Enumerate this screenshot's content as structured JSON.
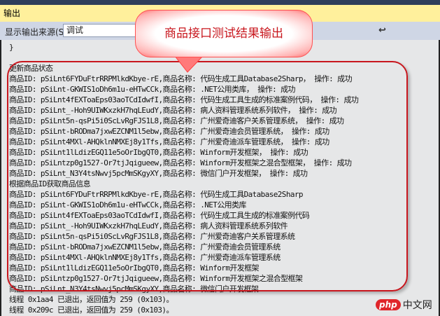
{
  "window": {
    "title": "输出"
  },
  "toolbar": {
    "source_label": "显示输出来源(S):",
    "source_value": "调试"
  },
  "callout": {
    "text": "商品接口测试结果输出"
  },
  "output": {
    "lines": [
      "}",
      "",
      "更新商品状态",
      "商品ID: pSiLnt6FYDuFtrRRPMlkdKbye-rE,商品名称: 代码生成工具Database2Sharp， 操作: 成功",
      "商品ID: pSiLnt-GKWIS1oDh6m1u-eHTwCCk,商品名称: .NET公用类库， 操作: 成功",
      "商品ID: pSiLnt4fEXToaEps03aoTCdIdwfI,商品名称: 代码生成工具生成的标准案例代码， 操作: 成功",
      "商品ID: pSiLnt_-Hoh9UIWKxzkH7hqLEudY,商品名称: 病人资料管理系统系列软件， 操作: 成功",
      "商品ID: pSiLnt5n-qsPi5i0ScLvRgFJS1L8,商品名称: 广州爱奇迪客户关系管理系统， 操作: 成功",
      "商品ID: pSiLnt-bRODma7jxwEZCNM1l5ebw,商品名称: 广州爱奇迪会员管理系统， 操作: 成功",
      "商品ID: pSiLnt4MXl-AHQklnNMXEj8y1Tfs,商品名称: 广州爱奇迪派车管理系统， 操作: 成功",
      "商品ID: pSiLnt1lLdizEGQ11e5oOrIbgQT0,商品名称: Winform开发框架， 操作: 成功",
      "商品ID: pSiLntzp0g1527-Or7tjJqigueew,商品名称: Winform开发框架之混合型框架， 操作: 成功",
      "商品ID: pSiLnt_N3Y4tsNwvj5pcMmSKgyXY,商品名称: 微信门户开发框架， 操作: 成功",
      "根据商品ID获取商品信息",
      "商品ID: pSiLnt6FYDuFtrRRPMlkdKbye-rE,商品名称: 代码生成工具Database2Sharp",
      "商品ID: pSiLnt-GKWIS1oDh6m1u-eHTwCCk,商品名称: .NET公用类库",
      "商品ID: pSiLnt4fEXToaEps03aoTCdIdwfI,商品名称: 代码生成工具生成的标准案例代码",
      "商品ID: pSiLnt_-Hoh9UIWKxzkH7hqLEudY,商品名称: 病人资料管理系统系列软件",
      "商品ID: pSiLnt5n-qsPi5i0ScLvRgFJS1L8,商品名称: 广州爱奇迪客户关系管理系统",
      "商品ID: pSiLnt-bRODma7jxwEZCNM1l5ebw,商品名称: 广州爱奇迪会员管理系统",
      "商品ID: pSiLnt4MXl-AHQklnNMXEj8y1Tfs,商品名称: 广州爱奇迪派车管理系统",
      "商品ID: pSiLnt1lLdizEGQ11e5oOrIbgQT0,商品名称: Winform开发框架",
      "商品ID: pSiLntzp0g1527-Or7tjJqigueew,商品名称: Winform开发框架之混合型框架",
      "商品ID: pSiLnt_N3Y4tsNwvj5pcMmSKgyXY,商品名称: 微信门户开发框架",
      "线程 0x1aa4 已退出，返回值为 259 (0x103)。",
      "线程 0x209c 已退出，返回值为 259 (0x103)。"
    ]
  },
  "watermark": {
    "brand": "php",
    "text": "中文网"
  },
  "colors": {
    "title_bar": "#fff09c",
    "toolbar": "#cfd6e5",
    "highlight": "#c8161d"
  }
}
